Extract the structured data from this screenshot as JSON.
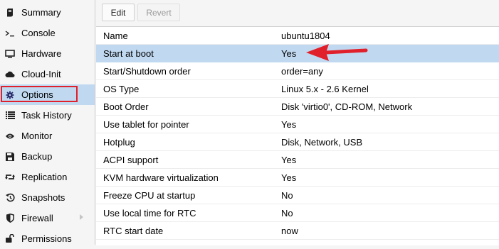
{
  "sidebar": {
    "items": [
      {
        "label": "Summary",
        "icon": "summary-icon"
      },
      {
        "label": "Console",
        "icon": "terminal-icon"
      },
      {
        "label": "Hardware",
        "icon": "monitor-icon"
      },
      {
        "label": "Cloud-Init",
        "icon": "cloud-icon"
      },
      {
        "label": "Options",
        "icon": "gear-icon",
        "selected": true
      },
      {
        "label": "Task History",
        "icon": "list-icon"
      },
      {
        "label": "Monitor",
        "icon": "eye-icon"
      },
      {
        "label": "Backup",
        "icon": "floppy-icon"
      },
      {
        "label": "Replication",
        "icon": "retweet-icon"
      },
      {
        "label": "Snapshots",
        "icon": "history-icon"
      },
      {
        "label": "Firewall",
        "icon": "shield-icon"
      },
      {
        "label": "Permissions",
        "icon": "unlock-icon"
      }
    ]
  },
  "toolbar": {
    "edit_label": "Edit",
    "revert_label": "Revert"
  },
  "options": [
    {
      "key": "Name",
      "value": "ubuntu1804"
    },
    {
      "key": "Start at boot",
      "value": "Yes",
      "selected": true
    },
    {
      "key": "Start/Shutdown order",
      "value": "order=any"
    },
    {
      "key": "OS Type",
      "value": "Linux 5.x - 2.6 Kernel"
    },
    {
      "key": "Boot Order",
      "value": "Disk 'virtio0', CD-ROM, Network"
    },
    {
      "key": "Use tablet for pointer",
      "value": "Yes"
    },
    {
      "key": "Hotplug",
      "value": "Disk, Network, USB"
    },
    {
      "key": "ACPI support",
      "value": "Yes"
    },
    {
      "key": "KVM hardware virtualization",
      "value": "Yes"
    },
    {
      "key": "Freeze CPU at startup",
      "value": "No"
    },
    {
      "key": "Use local time for RTC",
      "value": "No"
    },
    {
      "key": "RTC start date",
      "value": "now"
    }
  ],
  "colors": {
    "selection": "#c0d9f1",
    "annotation_red": "#e0202a"
  }
}
